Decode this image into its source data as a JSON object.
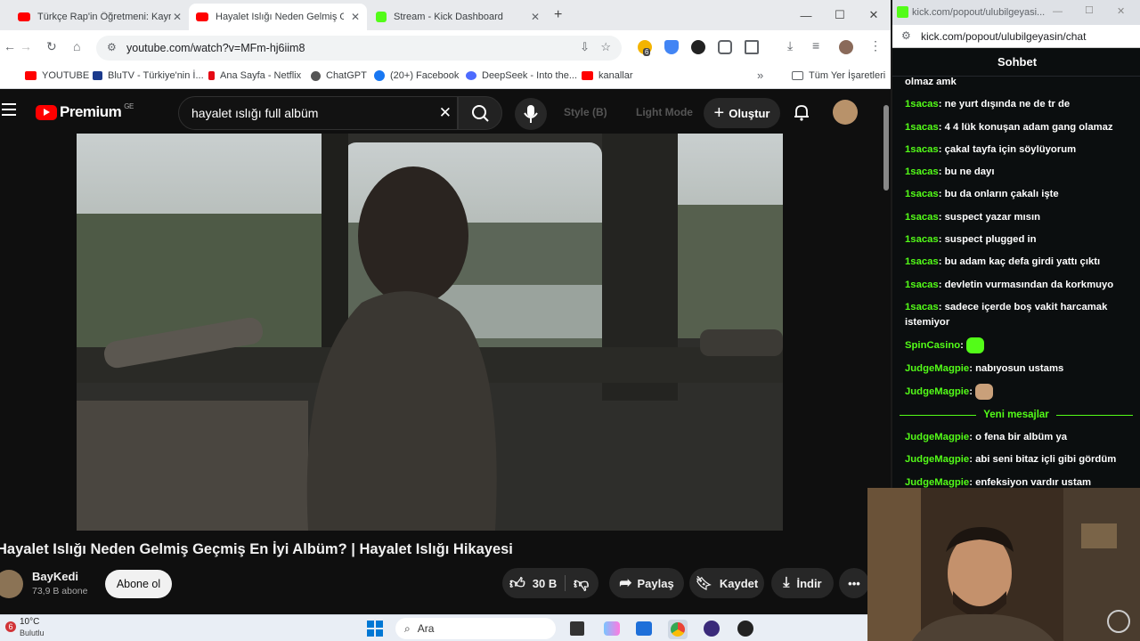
{
  "tabs": [
    {
      "title": "Türkçe Rap'in Öğretmeni: Kayra",
      "active": false
    },
    {
      "title": "Hayalet Islığı Neden Gelmiş Geç",
      "active": true
    },
    {
      "title": "Stream - Kick Dashboard",
      "active": false
    }
  ],
  "address": {
    "url": "youtube.com/watch?v=MFm-hj6iim8",
    "ext_badge": "6"
  },
  "bookmarks": [
    "YOUTUBE",
    "BluTV - Türkiye'nin İ...",
    "Ana Sayfa - Netflix",
    "ChatGPT",
    "(20+) Facebook",
    "DeepSeek - Into the...",
    "kanallar"
  ],
  "bookmarks_all": "Tüm Yer İşaretleri",
  "youtube": {
    "logo": "Premium",
    "region": "GE",
    "search": "hayalet ıslığı full albüm",
    "style_label": "Style (B)",
    "light_label": "Light Mode",
    "create_label": "Oluştur",
    "video_title": "Hayalet Islığı Neden Gelmiş Geçmiş En İyi Albüm? | Hayalet Islığı Hikayesi",
    "channel": "BayKedi",
    "subs": "73,9 B abone",
    "subscribe": "Abone ol",
    "likes": "30 B",
    "share": "Paylaş",
    "save": "Kaydet",
    "download": "İndir"
  },
  "kick": {
    "popout_url_short": "kick.com/popout/ulubilgeyasi...",
    "popout_url": "kick.com/popout/ulubilgeyasin/chat",
    "header": "Sohbet",
    "new_messages": "Yeni mesajlar",
    "messages": [
      {
        "user": "",
        "text": "olmaz amk"
      },
      {
        "user": "1sacas",
        "text": "ne yurt dışında ne de tr de"
      },
      {
        "user": "1sacas",
        "text": "4 4 lük konuşan adam gang olamaz"
      },
      {
        "user": "1sacas",
        "text": "çakal tayfa için söylüyorum"
      },
      {
        "user": "1sacas",
        "text": "bu ne dayı"
      },
      {
        "user": "1sacas",
        "text": "bu da onların çakalı işte"
      },
      {
        "user": "1sacas",
        "text": "suspect yazar mısın"
      },
      {
        "user": "1sacas",
        "text": "suspect plugged in"
      },
      {
        "user": "1sacas",
        "text": "bu adam kaç defa girdi yattı çıktı"
      },
      {
        "user": "1sacas",
        "text": "devletin vurmasından da korkmuyo"
      },
      {
        "user": "1sacas",
        "text": "sadece içerde boş vakit harcamak istemiyor"
      },
      {
        "user": "SpinCasino",
        "text": ""
      },
      {
        "user": "JudgeMagpie",
        "text": "nabıyosun ustams"
      },
      {
        "user": "JudgeMagpie",
        "text": ""
      }
    ],
    "new_list": [
      {
        "user": "JudgeMagpie",
        "text": "o fena bir albüm ya"
      },
      {
        "user": "JudgeMagpie",
        "text": "abi seni bitaz içli gibi gördüm"
      },
      {
        "user": "JudgeMagpie",
        "text": "enfeksiyon vardır ustam"
      }
    ]
  },
  "taskbar": {
    "weather_badge": "6",
    "temp": "10°C",
    "weather": "Bulutlu",
    "search": "Ara"
  }
}
